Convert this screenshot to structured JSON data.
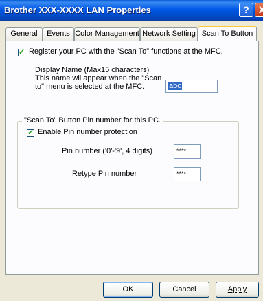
{
  "window": {
    "title": "Brother XXX-XXXX LAN Properties",
    "help_label": "?",
    "close_label": "X"
  },
  "tabs": [
    {
      "label": "General"
    },
    {
      "label": "Events"
    },
    {
      "label": "Color Management"
    },
    {
      "label": "Network Setting"
    },
    {
      "label": "Scan To Button",
      "active": true
    }
  ],
  "register": {
    "label": "Register your PC with the \"Scan To\" functions at the MFC.",
    "checked": true
  },
  "display_name": {
    "line1": "Display Name (Max15 characters)",
    "line2": "This name wil appear when the \"Scan",
    "line3": "to\" menu is selected at the MFC.",
    "value": "abc"
  },
  "pin_group": {
    "legend": "\"Scan To\" Button Pin number for this PC.",
    "enable_label": "Enable Pin number protection",
    "enable_checked": true,
    "pin_label": "Pin number ('0'-'9', 4 digits)",
    "pin_value": "****",
    "retype_label": "Retype Pin number",
    "retype_value": "****"
  },
  "buttons": {
    "ok": "OK",
    "cancel": "Cancel",
    "apply": "Apply"
  }
}
